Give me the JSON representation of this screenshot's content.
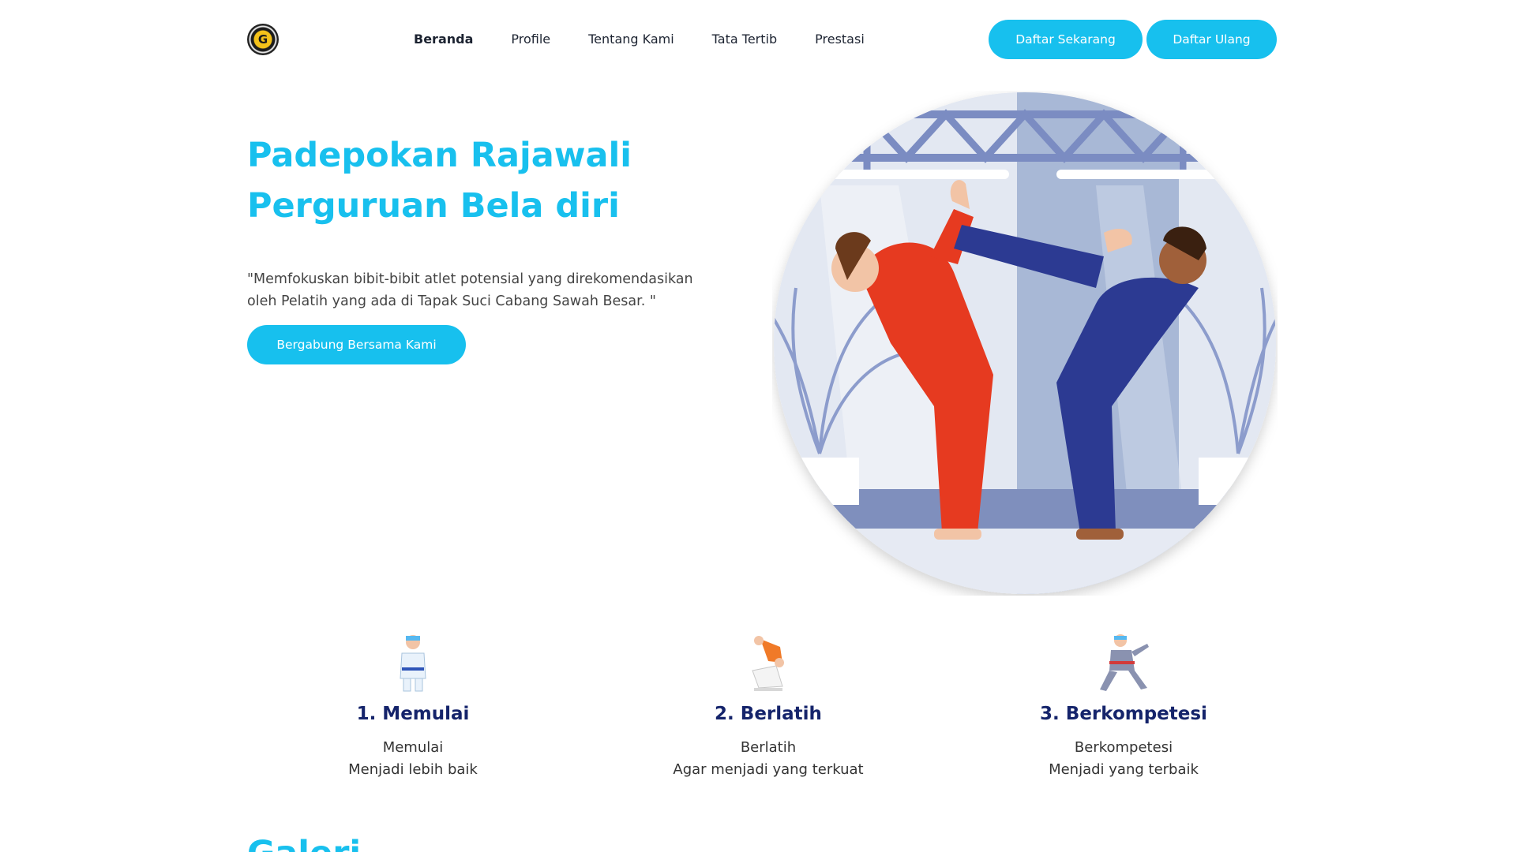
{
  "header": {
    "logo_text": "G",
    "nav": [
      {
        "label": "Beranda",
        "active": true
      },
      {
        "label": "Profile",
        "active": false
      },
      {
        "label": "Tentang Kami",
        "active": false
      },
      {
        "label": "Tata Tertib",
        "active": false
      },
      {
        "label": "Prestasi",
        "active": false
      }
    ],
    "btn_daftar": "Daftar Sekarang",
    "btn_ulang": "Daftar Ulang"
  },
  "hero": {
    "title_line1": "Padepokan Rajawali",
    "title_line2": "Perguruan Bela diri",
    "desc_line1": "\"Memfokuskan bibit-bibit atlet potensial yang direkomendasikan",
    "desc_line2": "oleh Pelatih yang ada di Tapak Suci Cabang Sawah Besar. \"",
    "join_button": "Bergabung Bersama Kami"
  },
  "features": [
    {
      "title": "1. Memulai",
      "line1": "Memulai",
      "line2": "Menjadi lebih baik"
    },
    {
      "title": "2. Berlatih",
      "line1": "Berlatih",
      "line2": "Agar menjadi yang terkuat"
    },
    {
      "title": "3. Berkompetesi",
      "line1": "Berkompetesi",
      "line2": "Menjadi yang terbaik"
    }
  ],
  "galeri_title": "Galeri",
  "colors": {
    "accent": "#17c0ee",
    "feature_title": "#15246b"
  }
}
